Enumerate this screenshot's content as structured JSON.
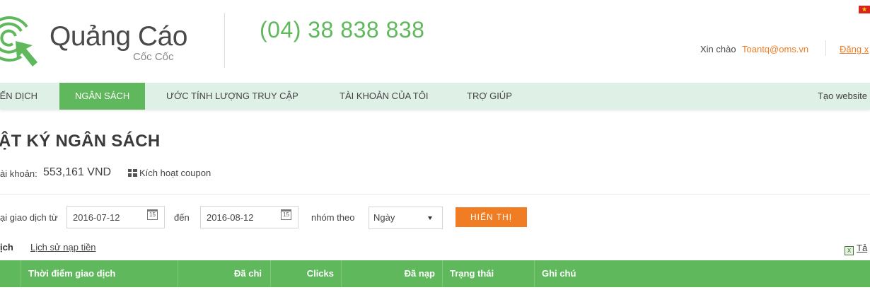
{
  "header": {
    "logo_text": "Quảng Cáo",
    "logo_sub": "Cốc Cốc",
    "phone": "(04) 38 838 838",
    "greeting": "Xin chào",
    "user_email": "Toantq@oms.vn",
    "logout_label": "Đăng x",
    "colors": {
      "brand_green": "#5fb85c",
      "accent_orange": "#f07d23"
    }
  },
  "nav": {
    "items": [
      {
        "label": "IẾN DỊCH"
      },
      {
        "label": "NGÂN SÁCH",
        "active": true
      },
      {
        "label": "ƯỚC TÍNH LƯỢNG TRUY CẬP"
      },
      {
        "label": "TÀI KHOẢN CỦA TÔI"
      },
      {
        "label": "TRỢ GIÚP"
      }
    ],
    "right_label": "Tạo website"
  },
  "main": {
    "title": "ẬT KÝ NGÂN SÁCH",
    "balance_label": "ài khoản:",
    "balance_value": "553,161 VND",
    "coupon_label": "Kích hoạt coupon",
    "filter": {
      "from_label": "ại giao dịch từ",
      "from_date": "2016-07-12",
      "to_label": "đến",
      "to_date": "2016-08-12",
      "group_label": "nhóm theo",
      "group_value": "Ngày",
      "calendar_glyph": "15",
      "show_button": "HIỂN THỊ"
    },
    "tabs": {
      "active": "ịch",
      "other": "Lịch sử nạp tiền"
    },
    "download_label": "Tả",
    "table": {
      "headers": [
        "Thời điểm giao dịch",
        "Đã chi",
        "Clicks",
        "Đã nạp",
        "Trạng thái",
        "Ghi chú"
      ]
    }
  }
}
